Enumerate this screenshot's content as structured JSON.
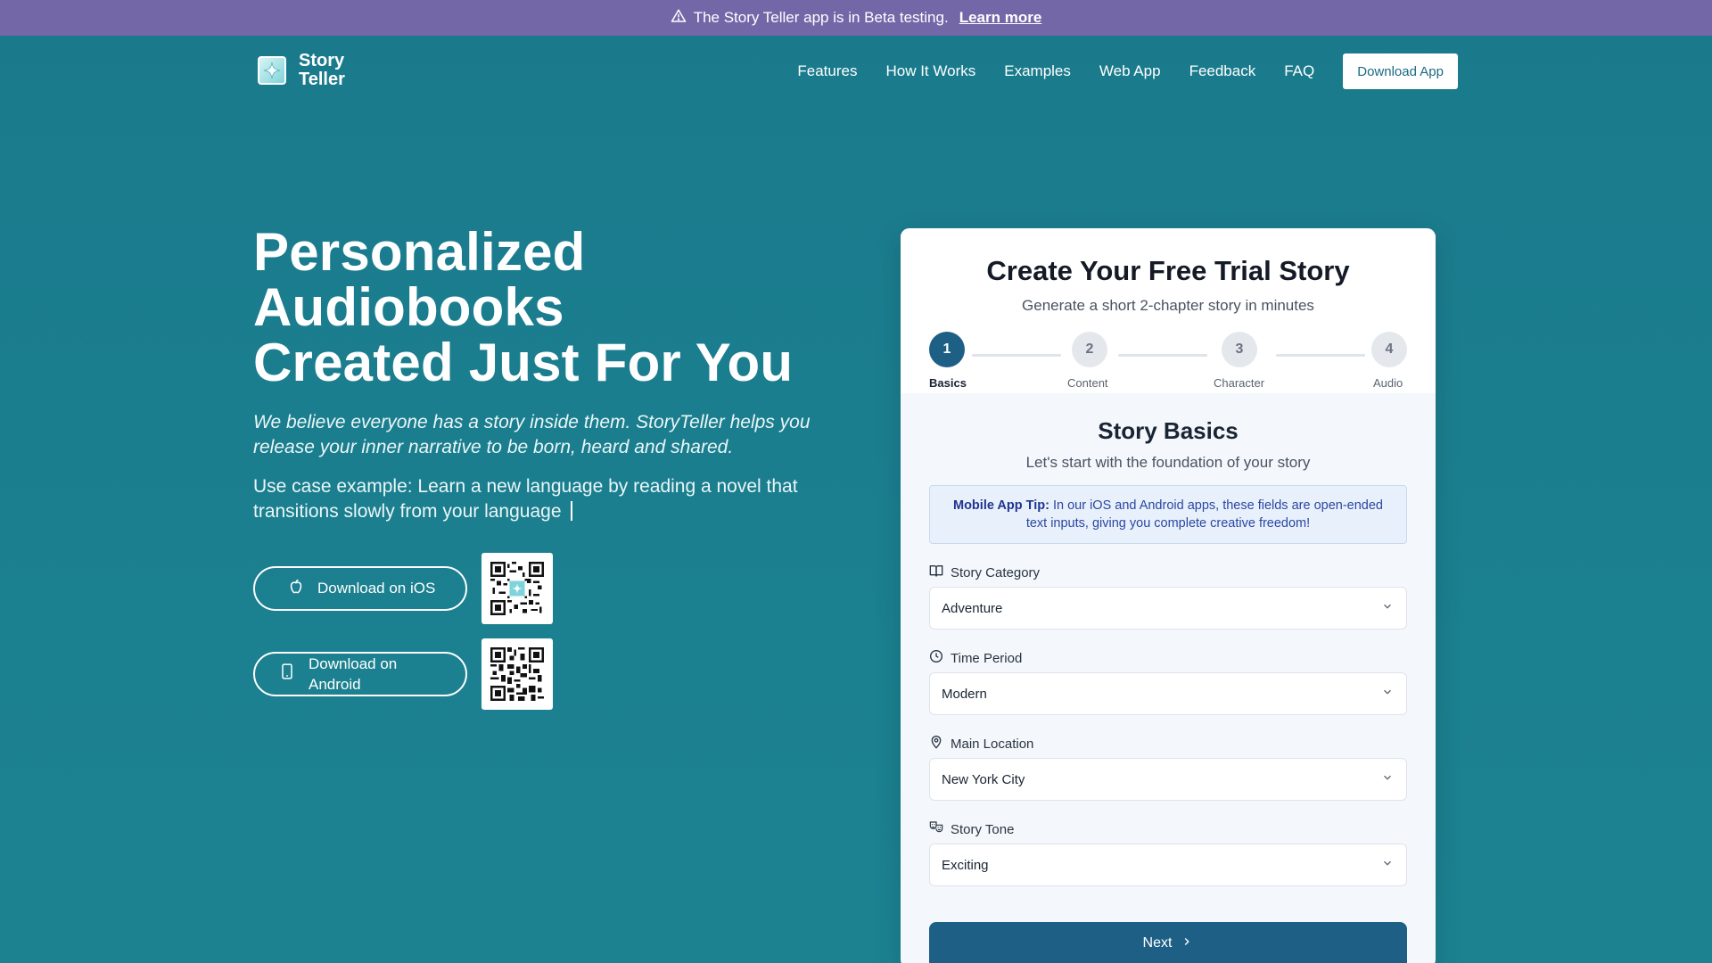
{
  "banner": {
    "icon": "warning-triangle-icon",
    "text": "The Story Teller app is in Beta testing.",
    "link": "Learn more"
  },
  "nav": {
    "logo_line1": "Story",
    "logo_line2": "Teller",
    "links": [
      "Features",
      "How It Works",
      "Examples",
      "Web App",
      "Feedback",
      "FAQ"
    ],
    "cta": "Download App"
  },
  "hero": {
    "title_lines": [
      "Personalized",
      "Audiobooks",
      "Created Just For You"
    ],
    "tagline": "We believe everyone has a story inside them. StoryTeller helps you release your inner narrative to be born, heard and shared.",
    "use_case": "Use case example: Learn a new language by reading a novel that transitions slowly from your language",
    "ios_button": "Download on iOS",
    "android_button_line1": "Download on",
    "android_button_line2": "Android"
  },
  "card": {
    "title": "Create Your Free Trial Story",
    "subtitle": "Generate a short 2-chapter story in minutes",
    "steps": [
      {
        "number": "1",
        "label": "Basics",
        "active": true
      },
      {
        "number": "2",
        "label": "Content",
        "active": false
      },
      {
        "number": "3",
        "label": "Character",
        "active": false
      },
      {
        "number": "4",
        "label": "Audio",
        "active": false
      }
    ],
    "section_title": "Story Basics",
    "section_subtitle": "Let's start with the foundation of your story",
    "tip_label": "Mobile App Tip:",
    "tip_text": " In our iOS and Android apps, these fields are open-ended text inputs, giving you complete creative freedom!",
    "fields": [
      {
        "label": "Story Category",
        "value": "Adventure",
        "icon": "book-icon"
      },
      {
        "label": "Time Period",
        "value": "Modern",
        "icon": "clock-icon"
      },
      {
        "label": "Main Location",
        "value": "New York City",
        "icon": "map-pin-icon"
      },
      {
        "label": "Story Tone",
        "value": "Exciting",
        "icon": "theater-masks-icon"
      }
    ],
    "next_button": "Next"
  },
  "colors": {
    "background": "#1a7a8c",
    "banner": "#7467a8",
    "primary": "#1e5f85",
    "card": "#f4f8fc"
  }
}
